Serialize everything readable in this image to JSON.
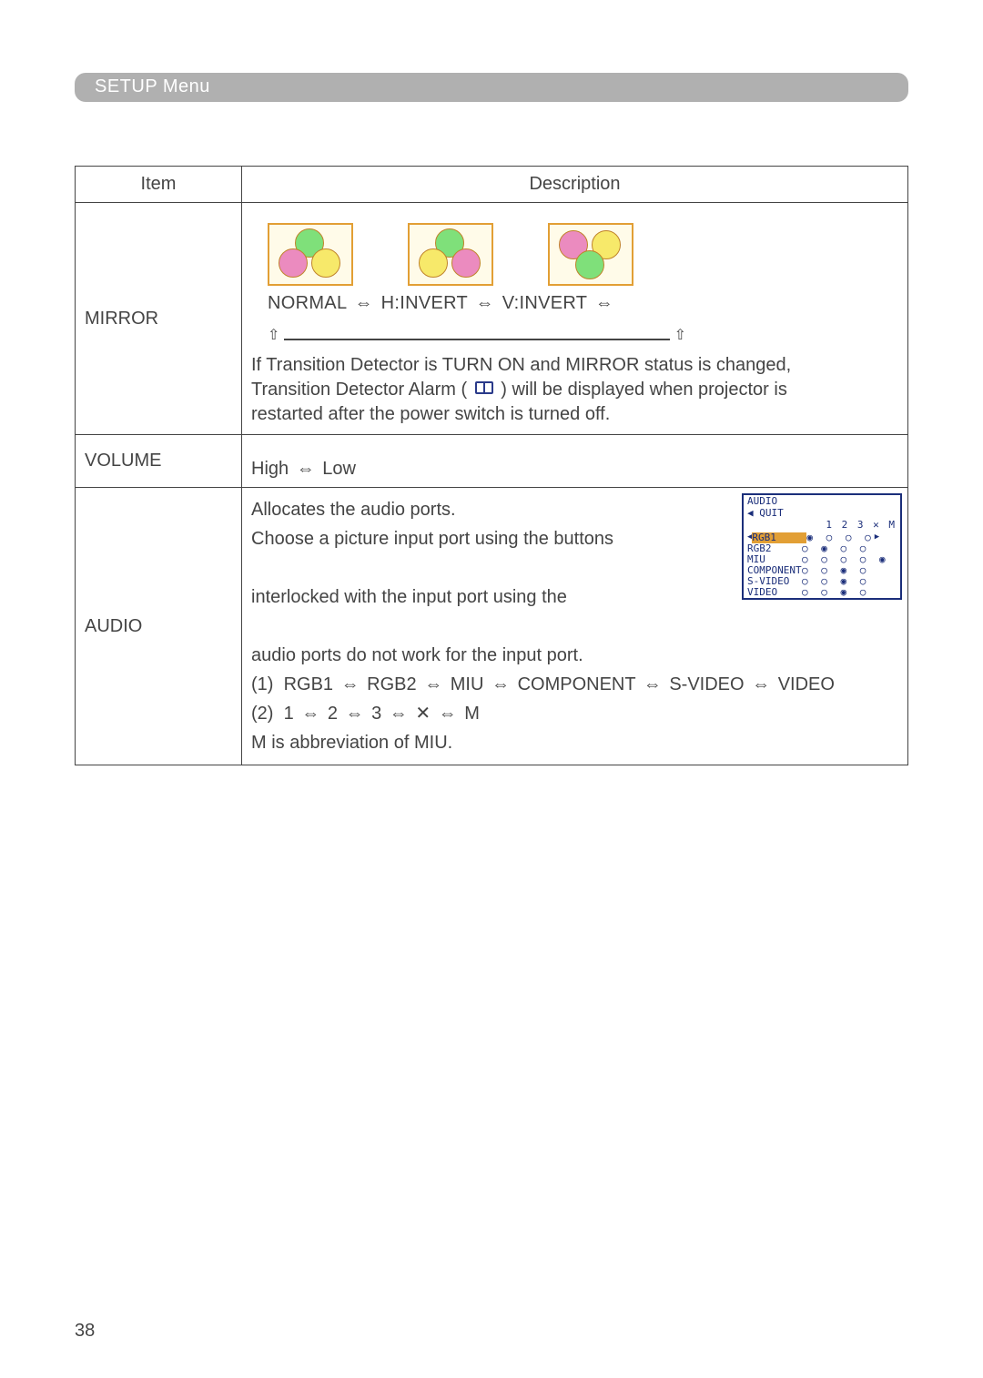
{
  "header": {
    "title": "SETUP Menu"
  },
  "table": {
    "headers": {
      "item": "Item",
      "description": "Description"
    },
    "rows": {
      "mirror": {
        "name": "MIRROR",
        "sequence_parts": [
          "NORMAL",
          "H:INVERT",
          "V:INVERT"
        ],
        "note_line1": "If Transition Detector is TURN ON and MIRROR status is changed,",
        "note_line2_a": "Transition Detector Alarm (",
        "note_line2_b": ") will be displayed when projector is",
        "note_line3": "restarted after the power switch is turned off."
      },
      "volume": {
        "name": "VOLUME",
        "high": "High",
        "low": "Low"
      },
      "audio": {
        "name": "AUDIO",
        "l1": "Allocates the audio ports.",
        "l2": "Choose a picture input port using the buttons",
        "l3": "interlocked with the input port using the",
        "l4": "audio ports do not work for the input port.",
        "seq1_label": "(1)",
        "seq1_parts": [
          "RGB1",
          "RGB2",
          "MIU",
          "COMPONENT",
          "S-VIDEO",
          "VIDEO"
        ],
        "seq2_label": "(2)",
        "seq2_parts": [
          "1",
          "2",
          "3",
          "✕",
          "M"
        ],
        "abbr": "M is abbreviation of MIU.",
        "osd": {
          "title": "AUDIO",
          "quit": "◀ QUIT",
          "cols": "1  2  3  ✕  M",
          "rows": [
            "RGB1",
            "RGB2",
            "MIU",
            "COMPONENT",
            "S-VIDEO",
            "VIDEO"
          ],
          "dots": [
            "◉ ○ ○ ○",
            "○ ◉ ○ ○",
            "○ ○ ○ ○ ◉",
            "○ ○ ◉ ○",
            "○ ○ ◉ ○",
            "○ ○ ◉ ○"
          ]
        }
      }
    }
  },
  "page_number": "38"
}
